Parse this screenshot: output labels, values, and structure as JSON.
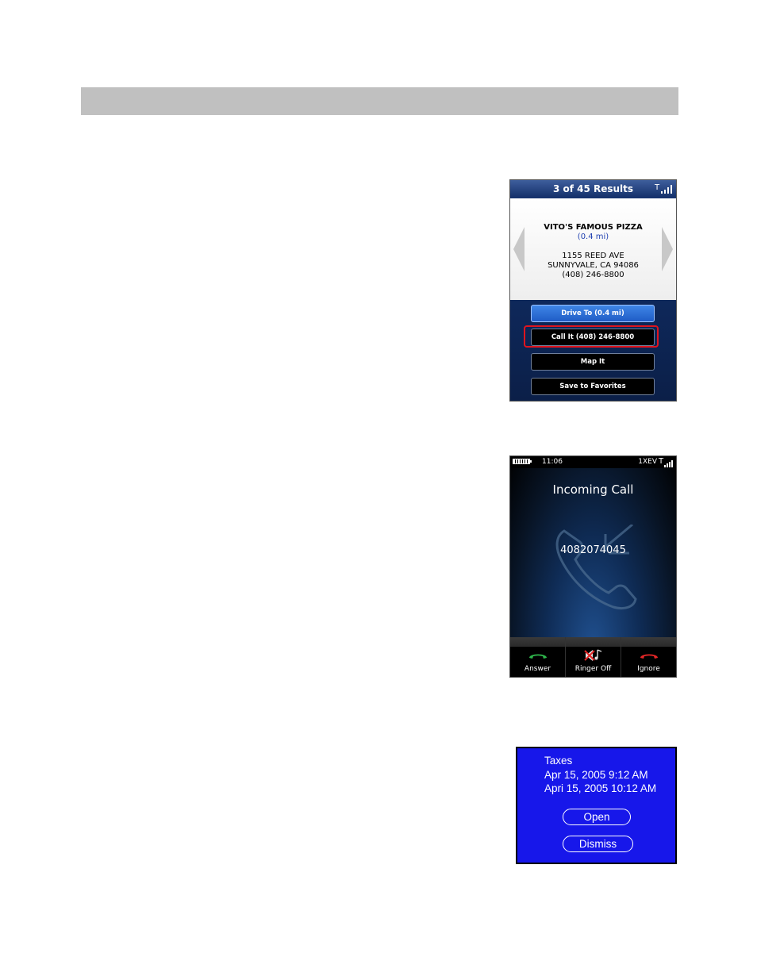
{
  "search_result": {
    "header": "3 of 45 Results",
    "business_name": "VITO'S FAMOUS PIZZA",
    "distance": "(0.4 mi)",
    "address_line1": "1155 REED AVE",
    "address_line2": "SUNNYVALE, CA 94086",
    "phone": "(408) 246-8800",
    "buttons": [
      "Drive To (0.4 mi)",
      "Call It (408) 246-8800",
      "Map It",
      "Save to Favorites"
    ]
  },
  "incoming_call": {
    "time": "11:06",
    "network": "1XEV",
    "title": "Incoming Call",
    "number": "4082074045",
    "actions": [
      "Answer",
      "Ringer Off",
      "Ignore"
    ]
  },
  "reminder": {
    "title": "Taxes",
    "start": "Apr 15, 2005 9:12 AM",
    "end": "Apri 15, 2005 10:12 AM",
    "open_label": "Open",
    "dismiss_label": "Dismiss"
  },
  "colors": {
    "highlight": "#e0141e",
    "reminder_bg": "#1717ea",
    "answer": "#2eb34a",
    "ignore": "#e32626"
  }
}
